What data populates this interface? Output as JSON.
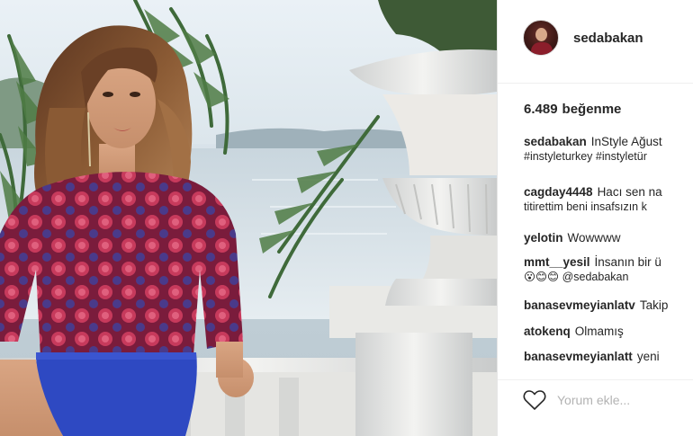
{
  "post": {
    "username": "sedabakan",
    "likes_count": "6.489",
    "likes_label": "beğenme",
    "add_comment_placeholder": "Yorum ekle..."
  },
  "comments": [
    {
      "user": "sedabakan",
      "text": "InStyle Ağust",
      "line2": "#instyleturkey #instyletür"
    },
    {
      "user": "cagday4448",
      "text": "Hacı sen na",
      "line2": "titirettim beni insafsızın k"
    },
    {
      "user": "yelotin",
      "text": "Wowwww"
    },
    {
      "user": "mmt__yesil",
      "text": "İnsanın bir ü",
      "line2": "😮😊😊 @sedabakan"
    },
    {
      "user": "banasevmeyianlatv",
      "text": "Takip"
    },
    {
      "user": "atokenq",
      "text": "Olmamış"
    },
    {
      "user": "banasevmeyianlatt",
      "text": "yeni"
    }
  ],
  "icons": {
    "like": "heart-outline-icon"
  },
  "colors": {
    "hashtag": "#3d5a80",
    "text": "#262626",
    "placeholder": "#b3b3b3"
  }
}
